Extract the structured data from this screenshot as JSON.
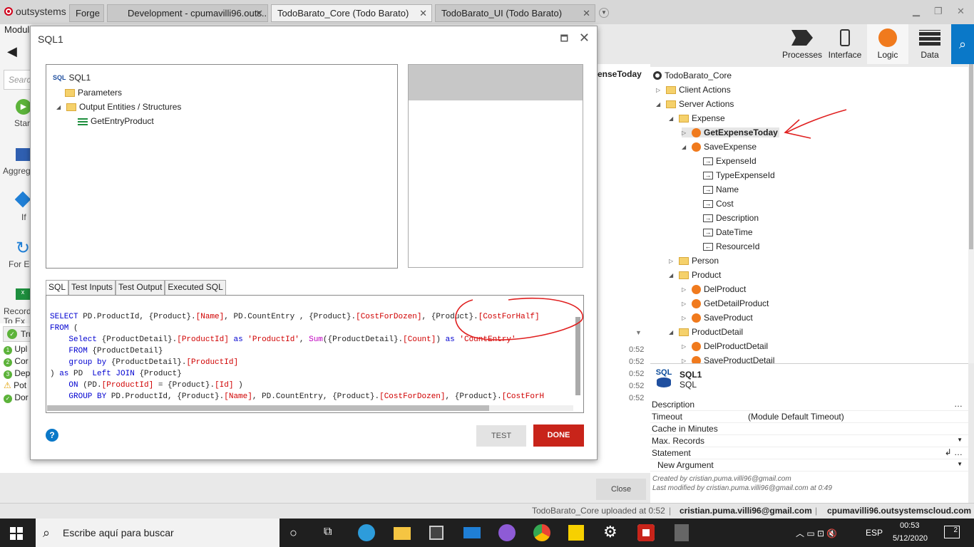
{
  "tabs": {
    "logo": "outsystems",
    "forge": "Forge",
    "development": "Development - cpumavilli96.outs...",
    "core": "TodoBarato_Core (Todo Barato)",
    "ui": "TodoBarato_UI (Todo Barato)"
  },
  "left": {
    "module": "Modul",
    "search_placeholder": "Searc",
    "tools": [
      "Star",
      "Aggreg",
      "If",
      "For Ea",
      "Record\nTo Ex"
    ],
    "truetab": "Tru",
    "logs": [
      "Upl",
      "Cor",
      "Dep",
      "Pot",
      "Dor"
    ],
    "times": [
      "0:52",
      "0:52",
      "0:52",
      "0:52",
      "0:52"
    ],
    "breadcrumb": "enseToday"
  },
  "toolbar": {
    "processes": "Processes",
    "interface": "Interface",
    "logic": "Logic",
    "data": "Data",
    "accent": "#0a78c8"
  },
  "tree": {
    "root": "TodoBarato_Core",
    "client_actions": "Client Actions",
    "server_actions": "Server Actions",
    "expense": "Expense",
    "get_expense_today": "GetExpenseToday",
    "save_expense": "SaveExpense",
    "params": [
      "ExpenseId",
      "TypeExpenseId",
      "Name",
      "Cost",
      "Description",
      "DateTime",
      "ResourceId"
    ],
    "person": "Person",
    "product": "Product",
    "product_actions": [
      "DelProduct",
      "GetDetailProduct",
      "SaveProduct"
    ],
    "product_detail": "ProductDetail",
    "product_detail_actions": [
      "DelProductDetail",
      "SaveProductDetail"
    ]
  },
  "props": {
    "title": "SQL1",
    "subtitle": "SQL",
    "rows": [
      {
        "k": "Description",
        "v": ""
      },
      {
        "k": "Timeout",
        "v": "(Module Default Timeout)"
      },
      {
        "k": "Cache in Minutes",
        "v": ""
      },
      {
        "k": "Max. Records",
        "v": ""
      },
      {
        "k": "Statement",
        "v": ""
      },
      {
        "k": "New Argument",
        "v": ""
      }
    ],
    "created": "Created by cristian.puma.villi96@gmail.com",
    "modified": "Last modified by cristian.puma.villi96@gmail.com at 0:49"
  },
  "modal": {
    "title": "SQL1",
    "tree_root": "SQL1",
    "parameters": "Parameters",
    "output": "Output Entities / Structures",
    "entry": "GetEntryProduct",
    "tabs": [
      "SQL",
      "Test Inputs",
      "Test Output",
      "Executed SQL"
    ],
    "test": "TEST",
    "done": "DONE",
    "close": "Close"
  },
  "status": {
    "uploaded": "TodoBarato_Core uploaded at 0:52",
    "user": "cristian.puma.villi96@gmail.com",
    "server": "cpumavilli96.outsystemscloud.com"
  },
  "taskbar": {
    "search": "Escribe aquí para buscar",
    "lang": "ESP",
    "time": "00:53",
    "date": "5/12/2020",
    "notif": "2"
  }
}
